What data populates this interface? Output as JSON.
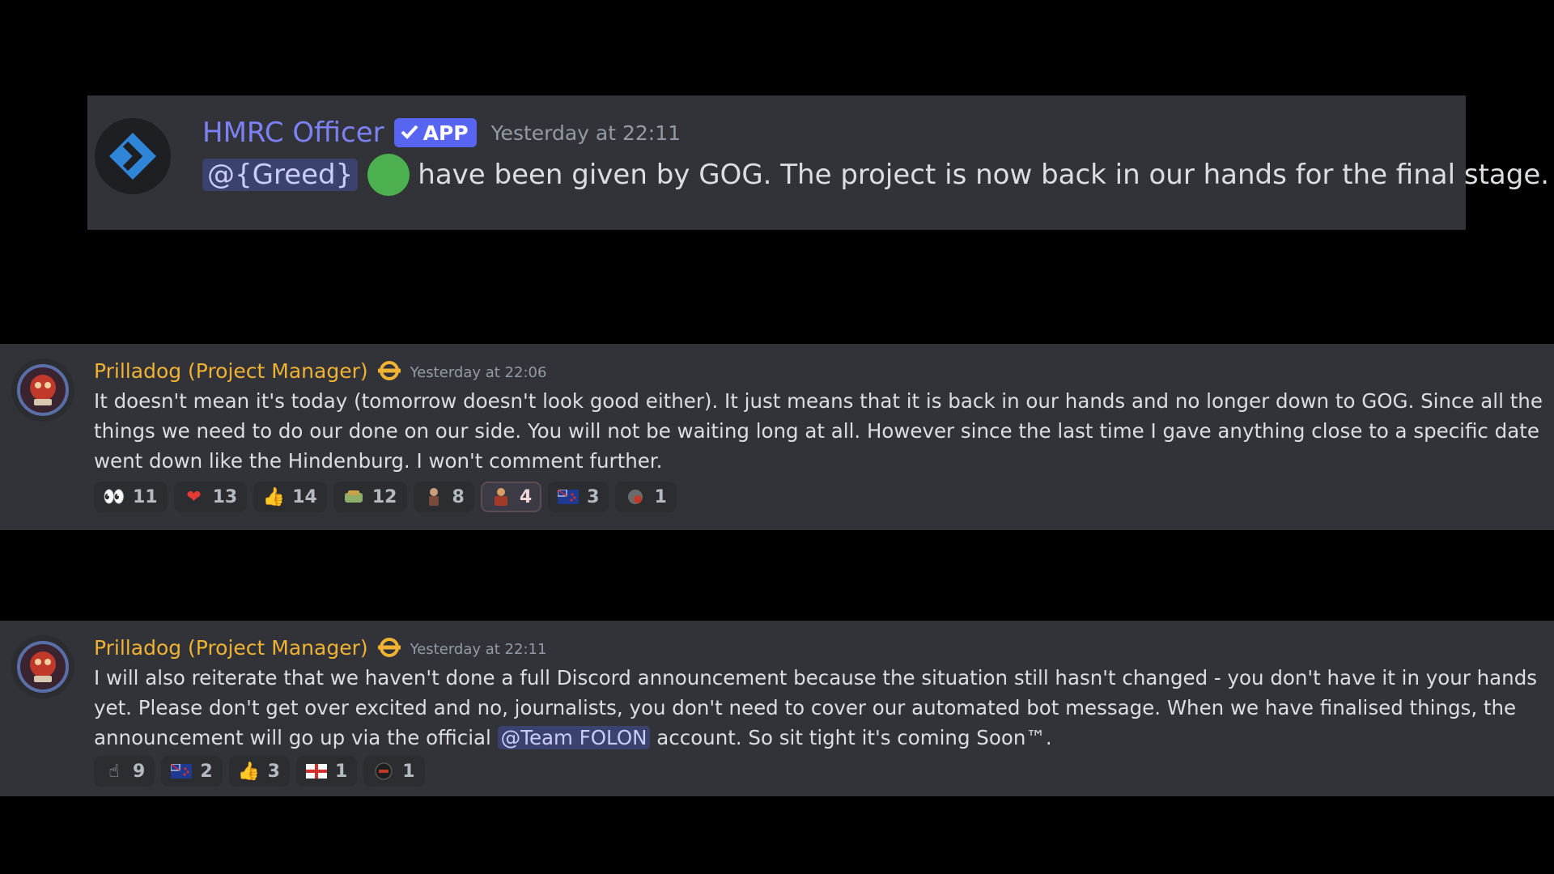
{
  "post1": {
    "username": "HMRC Officer",
    "badge": "APP",
    "timestamp": "Yesterday at 22:11",
    "mention": "@{Greed}",
    "text": "have been given by GOG. The project is now back in our hands for the final stage."
  },
  "post2": {
    "username": "Prilladog (Project Manager)",
    "timestamp": "Yesterday at 22:06",
    "text": "It doesn't mean it's today (tomorrow doesn't look good either). It just means that it is back in our hands and no longer down to GOG. Since all the things we need to do our done on our side. You will not be waiting long at all. However since the last time I gave anything close to a specific date went down like the Hindenburg. I won't comment further.",
    "reactions": [
      {
        "icon": "eyes-emoji",
        "glyph": "👀",
        "count": "11"
      },
      {
        "icon": "red-heart-emoji",
        "glyph": "❤",
        "count": "13"
      },
      {
        "icon": "thumbs-up-emoji",
        "glyph": "👍",
        "count": "14"
      },
      {
        "icon": "custom-emoji-1",
        "glyph": "",
        "count": "12"
      },
      {
        "icon": "custom-emoji-2",
        "glyph": "",
        "count": "8"
      },
      {
        "icon": "custom-emoji-3",
        "glyph": "",
        "count": "4"
      },
      {
        "icon": "nz-flag-emoji",
        "glyph": "",
        "count": "3"
      },
      {
        "icon": "custom-emoji-4",
        "glyph": "",
        "count": "1"
      }
    ]
  },
  "post3": {
    "username": "Prilladog (Project Manager)",
    "timestamp": "Yesterday at 22:11",
    "text_before": "I will also reiterate that we haven't done a full Discord announcement because the situation still hasn't changed - you don't have it in your hands yet. Please don't get over excited and no, journalists, you don't need to cover our automated bot message. When we have finalised things, the announcement will go up via the official ",
    "mention": "@Team FOLON",
    "text_after": " account. So sit tight it's coming Soon™.",
    "reactions": [
      {
        "icon": "pointing-up-emoji",
        "glyph": "☝",
        "count": "9"
      },
      {
        "icon": "nz-flag-emoji",
        "glyph": "",
        "count": "2"
      },
      {
        "icon": "thumbs-up-emoji",
        "glyph": "👍",
        "count": "3"
      },
      {
        "icon": "england-flag-emoji",
        "glyph": "",
        "count": "1"
      },
      {
        "icon": "custom-emoji-5",
        "glyph": "",
        "count": "1"
      }
    ]
  },
  "colors": {
    "bot_name": "#7c82f5",
    "app_badge": "#5865f2",
    "project_manager_name": "#f0b232",
    "mention_bg": "#3c4270",
    "panel_bg": "#323339"
  }
}
